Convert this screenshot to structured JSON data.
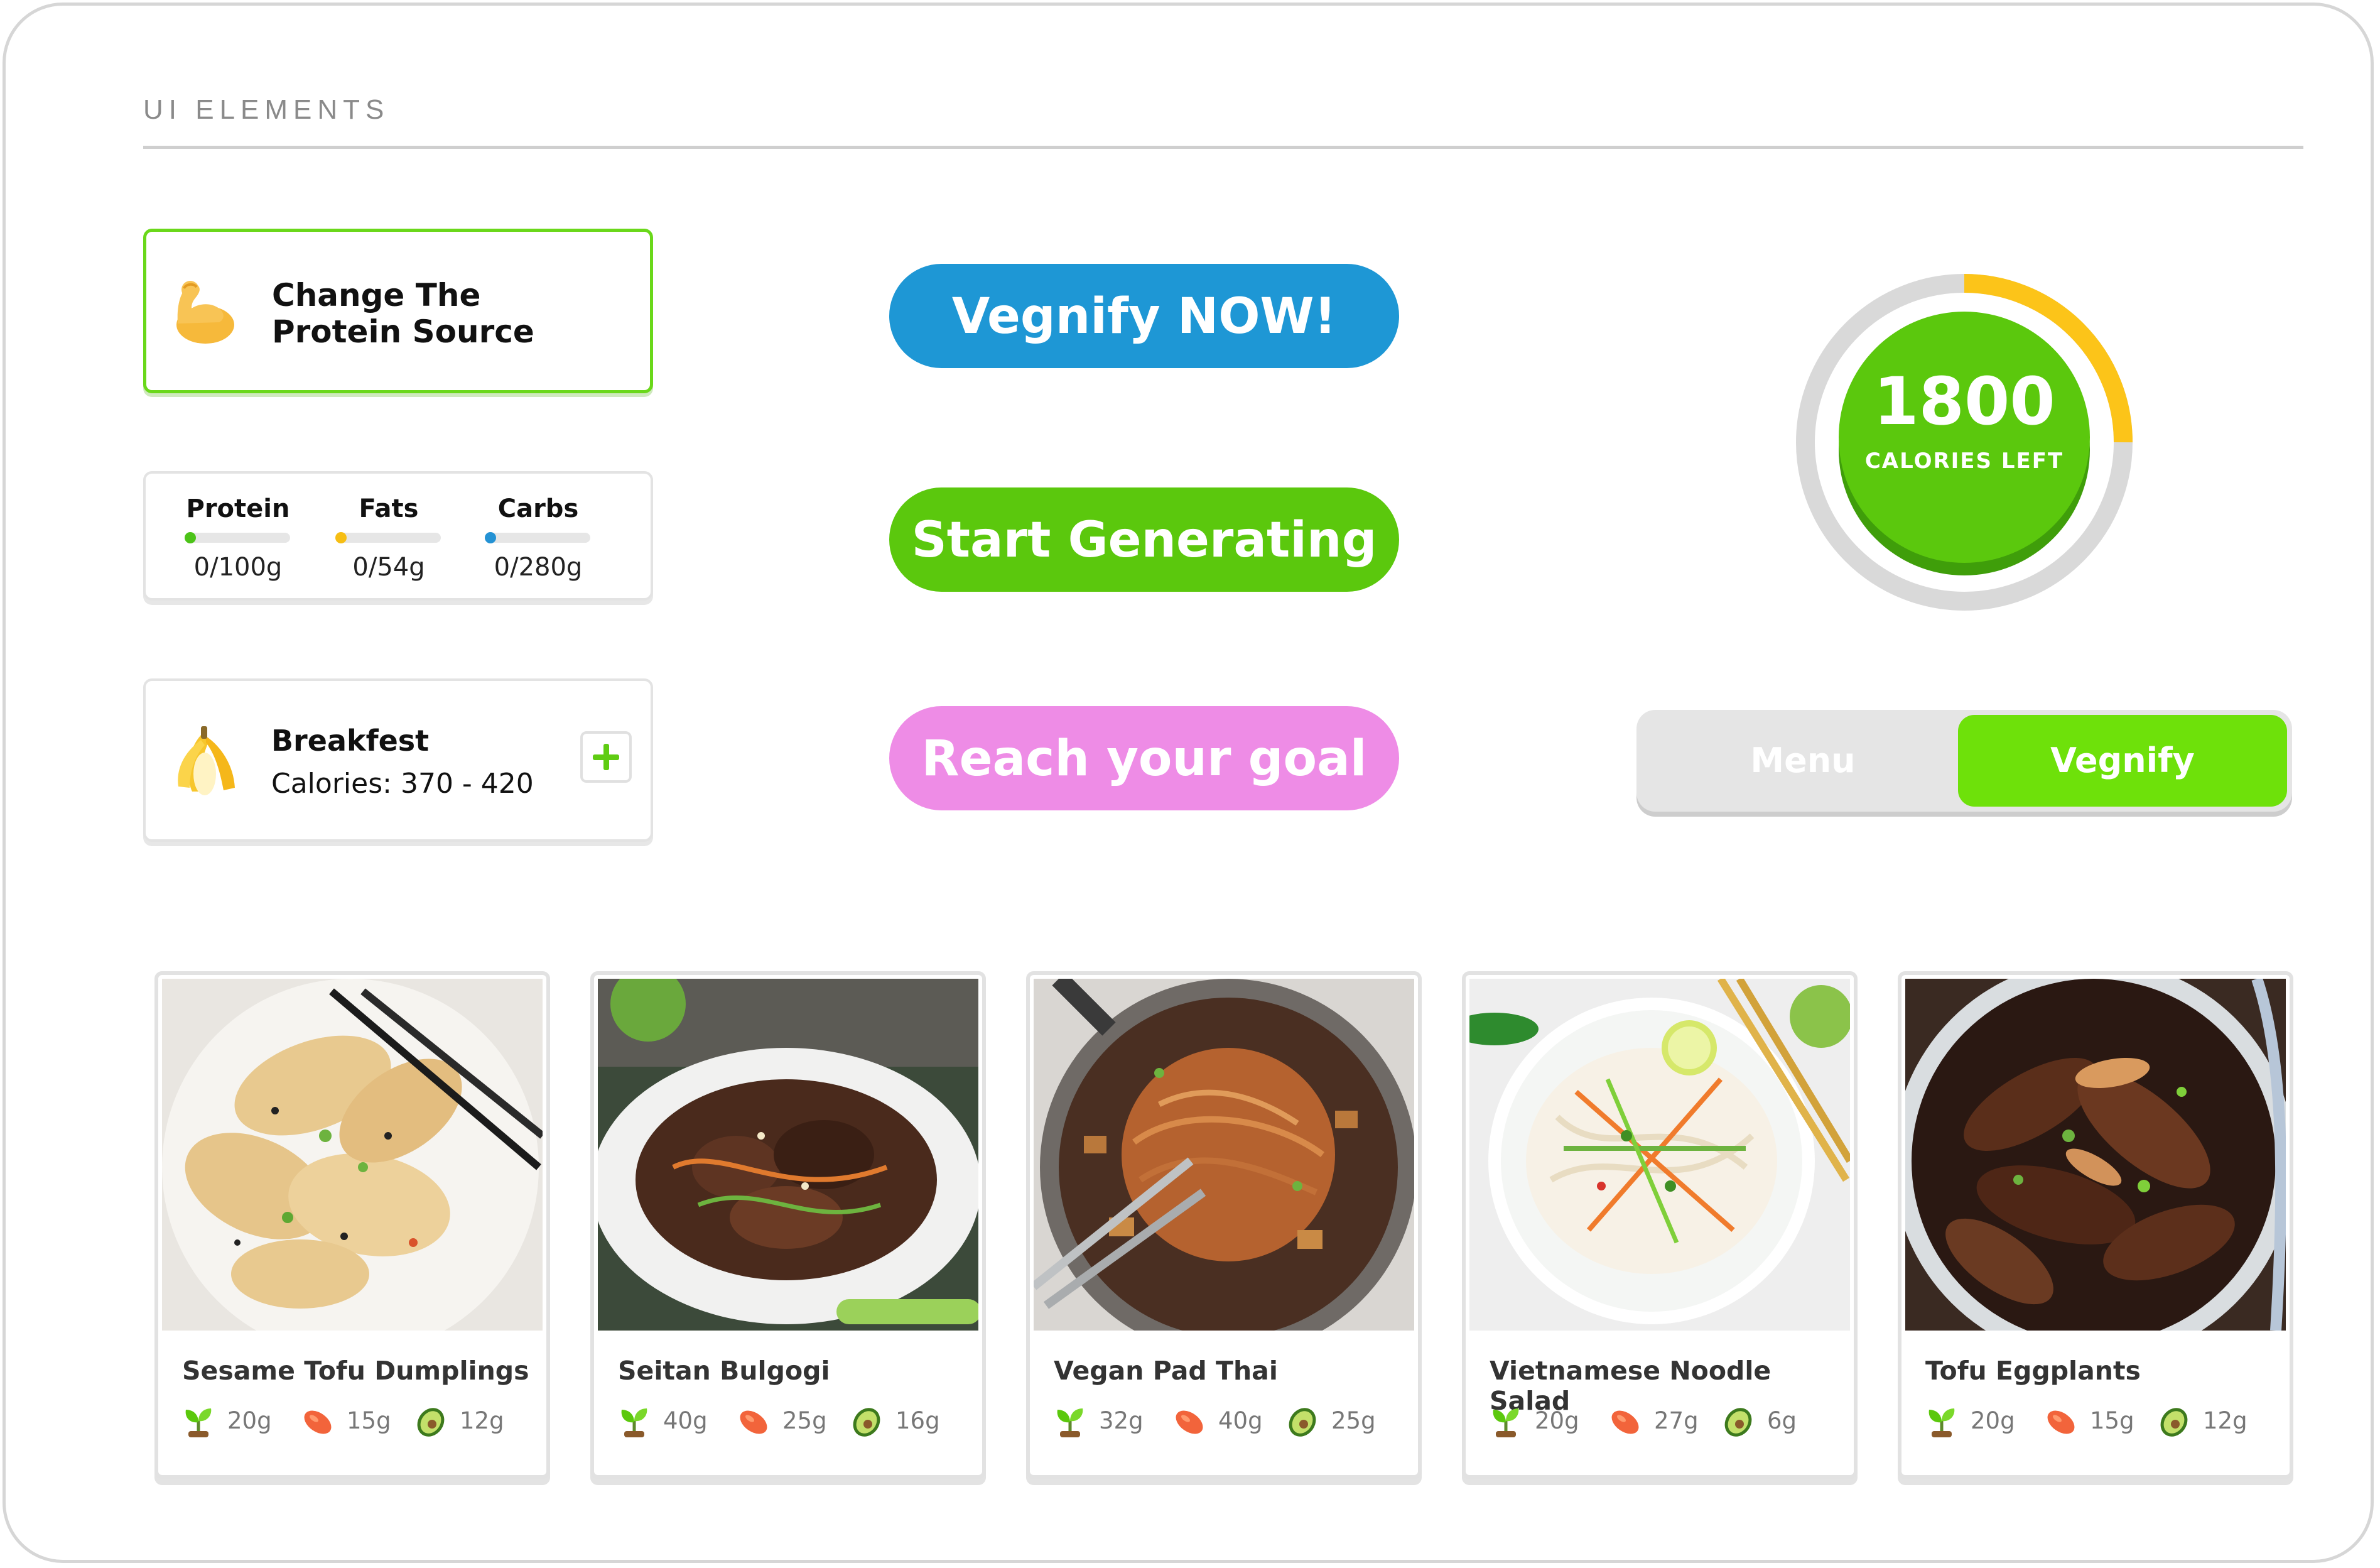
{
  "section": {
    "title": "UI ELEMENTS"
  },
  "protein_card": {
    "icon": "flexed-biceps-emoji",
    "line1": "Change The",
    "line2": "Protein Source"
  },
  "macros": [
    {
      "label": "Protein",
      "value": "0/100g",
      "progress": 0,
      "color": "#4cc318"
    },
    {
      "label": "Fats",
      "value": "0/54g",
      "progress": 0,
      "color": "#f6be14"
    },
    {
      "label": "Carbs",
      "value": "0/280g",
      "progress": 0,
      "color": "#2492d4"
    }
  ],
  "meal": {
    "icon": "banana-emoji",
    "title": "Breakfest",
    "calories": "Calories: 370 - 420"
  },
  "buttons": {
    "vegnify_now": "Vegnify NOW!",
    "start_generating": "Start Generating",
    "reach_goal": "Reach your goal"
  },
  "calories": {
    "number": "1800",
    "caption": "CALORIES LEFT",
    "consumed_fraction": 0.25
  },
  "toggle": {
    "options": [
      "Menu",
      "Vegnify"
    ],
    "selected": "Vegnify"
  },
  "colors": {
    "green": "#5bc80d",
    "blue": "#1e97d5",
    "pink": "#ee8ce6",
    "yellow": "#fcc419",
    "ring_grey": "#d9d9d9"
  },
  "recipes": [
    {
      "name": "Sesame Tofu Dumplings",
      "protein": "20g",
      "fat": "15g",
      "carbs": "12g",
      "photo": "dumplings-photo"
    },
    {
      "name": "Seitan Bulgogi",
      "protein": "40g",
      "fat": "25g",
      "carbs": "16g",
      "photo": "bulgogi-photo"
    },
    {
      "name": "Vegan Pad Thai",
      "protein": "32g",
      "fat": "40g",
      "carbs": "25g",
      "photo": "pad-thai-photo"
    },
    {
      "name": "Vietnamese Noodle Salad",
      "protein": "20g",
      "fat": "27g",
      "carbs": "6g",
      "photo": "noodle-salad-photo"
    },
    {
      "name": "Tofu Eggplants",
      "protein": "20g",
      "fat": "15g",
      "carbs": "12g",
      "photo": "eggplant-photo"
    }
  ]
}
